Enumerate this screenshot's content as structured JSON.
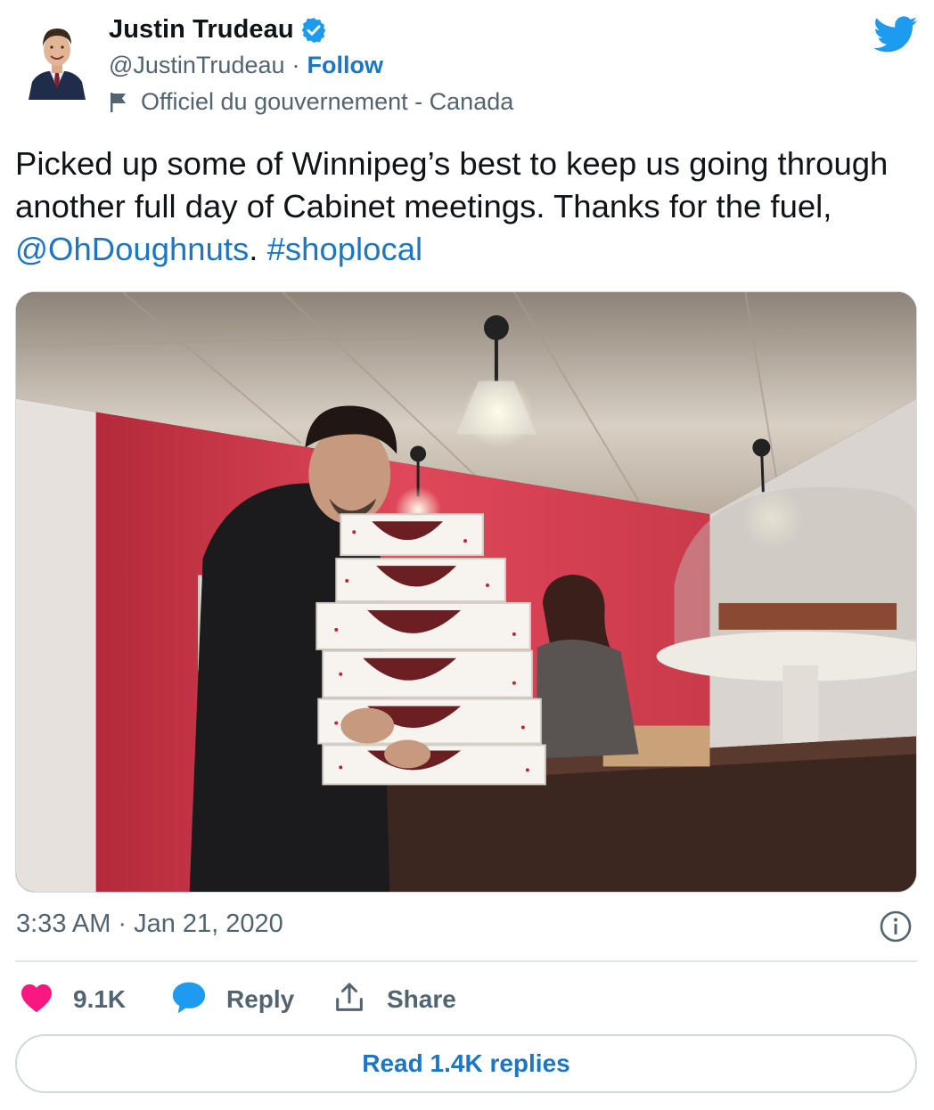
{
  "header": {
    "display_name": "Justin Trudeau",
    "handle": "@JustinTrudeau",
    "separator": "·",
    "follow_label": "Follow",
    "gov_label": "Officiel du gouvernement - Canada",
    "icons": [
      "avatar",
      "verified-badge-icon",
      "flag-icon",
      "twitter-logo-icon"
    ]
  },
  "tweet": {
    "text_before": "Picked up some of Winnipeg’s best to keep us going through another full day of Cabinet meetings. Thanks for the fuel, ",
    "mention": "@OhDoughnuts",
    "text_middle": ". ",
    "hashtag": "#shoplocal"
  },
  "meta": {
    "time": "3:33 AM",
    "separator": "·",
    "date": "Jan 21, 2020"
  },
  "actions": {
    "like_count": "9.1K",
    "reply_label": "Reply",
    "share_label": "Share",
    "read_replies_label": "Read 1.4K replies"
  },
  "colors": {
    "link_blue": "#1d76c4",
    "like_pink": "#f91880",
    "twitter_blue": "#1d9bf0",
    "muted_text": "#536471"
  }
}
